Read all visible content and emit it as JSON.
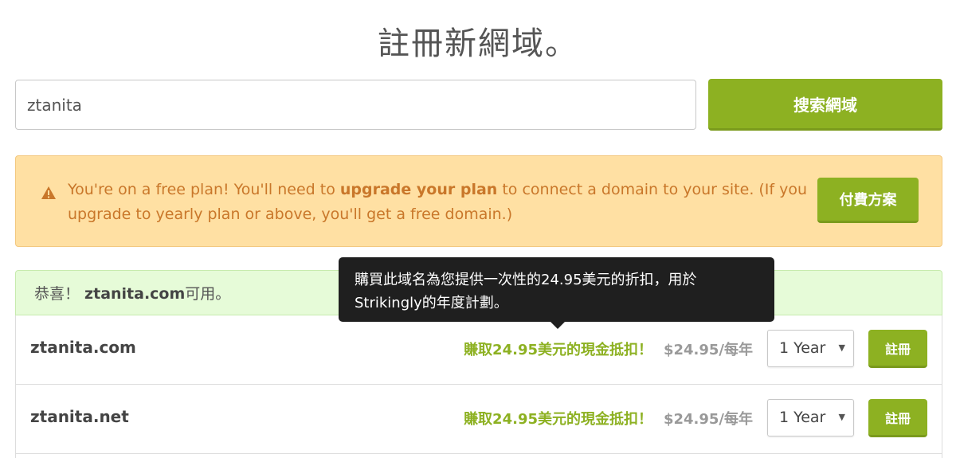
{
  "page": {
    "title": "註冊新網域。"
  },
  "search": {
    "value": "ztanita",
    "button_label": "搜索網域"
  },
  "warning": {
    "icon": "warning-triangle-icon",
    "text_before": "You're on a free plan! You'll need to ",
    "text_bold": "upgrade your plan",
    "text_after": " to connect a domain to your site. (If you upgrade to yearly plan or above, you'll get a free domain.)",
    "button_label": "付費方案"
  },
  "availability": {
    "prefix": "恭喜！ ",
    "domain": "ztanita.com",
    "suffix": "可用。"
  },
  "tooltip": {
    "text": "購買此域名為您提供一次性的24.95美元的折扣，用於Strikingly的年度計劃。"
  },
  "results": [
    {
      "domain": "ztanita.com",
      "cashback": "賺取24.95美元的現金抵扣！",
      "price_amount": "$24.95",
      "price_period": "/每年",
      "term": "1 Year",
      "register_label": "註冊"
    },
    {
      "domain": "ztanita.net",
      "cashback": "賺取24.95美元的現金抵扣！",
      "price_amount": "$24.95",
      "price_period": "/每年",
      "term": "1 Year",
      "register_label": "註冊"
    }
  ],
  "colors": {
    "accent_green": "#8db122",
    "warning_bg": "#ffe0a3",
    "warning_text": "#c9772a",
    "success_bg": "#e6fbd8",
    "tooltip_bg": "#1f1f1f"
  }
}
